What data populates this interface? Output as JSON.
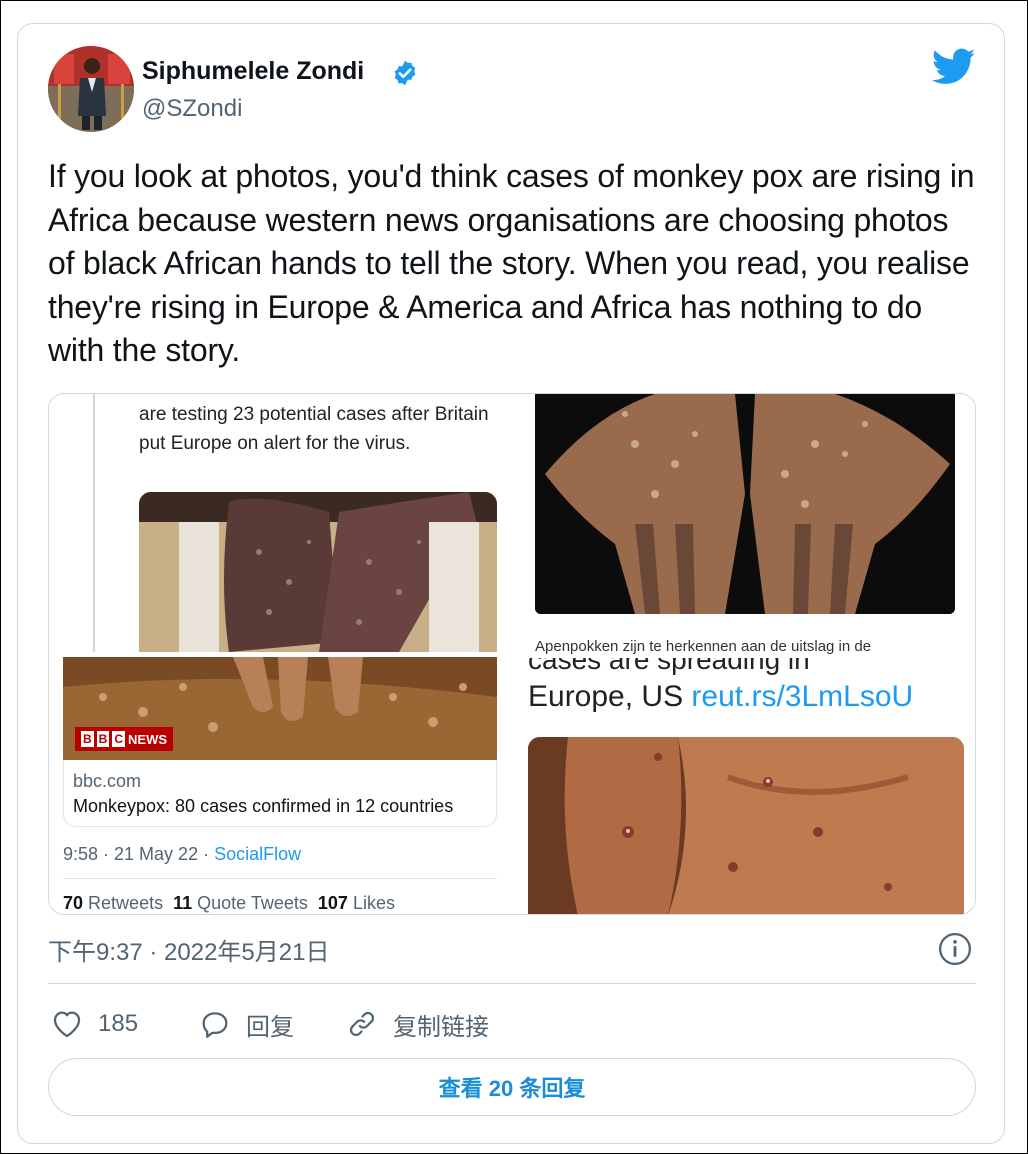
{
  "author": {
    "name": "Siphumelele Zondi",
    "handle": "@SZondi",
    "verified": true,
    "avatar_icon": "profile-photo"
  },
  "brand_icon": "twitter-bird-icon",
  "tweet": {
    "text": "If you look at photos, you'd think cases of monkey pox are rising in Africa because western news organisations are choosing photos of black African hands to tell the story. When you read, you realise they're rising in Europe & America and Africa has nothing to do with the story."
  },
  "media": {
    "left_panel": {
      "article_text": "are testing 23 potential cases after Britain put Europe on alert for the virus.",
      "bbc_logo_letters": [
        "B",
        "B",
        "C"
      ],
      "bbc_logo_word": "NEWS",
      "link_domain": "bbc.com",
      "link_title": "Monkeypox: 80 cases confirmed in 12 countries",
      "meta_time": "9:58 · 21 May 22 · ",
      "meta_source": "SocialFlow",
      "retweets_count": "70",
      "retweets_label": "Retweets",
      "quotes_count": "11",
      "quotes_label": "Quote Tweets",
      "likes_count": "107",
      "likes_label": "Likes"
    },
    "right_panel": {
      "caption": "Apenpokken zijn te herkennen aan de uitslag in de",
      "cut_text": "cases are spreading in",
      "line2_text": "Europe, US ",
      "line2_link": "reut.rs/3LmLsoU"
    }
  },
  "timestamp": "下午9:37 · 2022年5月21日",
  "actions": {
    "like_count": "185",
    "reply_label": "回复",
    "copy_link_label": "复制链接"
  },
  "view_replies_label": "查看 20 条回复",
  "colors": {
    "accent": "#1d9bf0",
    "text": "#0f1419",
    "muted": "#536471",
    "border": "#cfd9de",
    "bbc_red": "#b80000"
  }
}
